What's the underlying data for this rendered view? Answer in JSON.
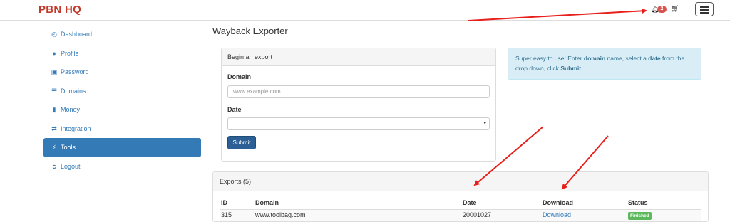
{
  "brand": "PBN HQ",
  "header": {
    "notification_count": "2",
    "bell_icon": "bell-icon",
    "cart_icon": "cart-icon",
    "menu_icon": "hamburger-icon"
  },
  "sidebar": {
    "items": [
      {
        "label": "Dashboard",
        "icon": "dashboard-icon"
      },
      {
        "label": "Profile",
        "icon": "user-icon"
      },
      {
        "label": "Password",
        "icon": "lock-icon"
      },
      {
        "label": "Domains",
        "icon": "server-icon"
      },
      {
        "label": "Money",
        "icon": "bar-chart-icon"
      },
      {
        "label": "Integration",
        "icon": "shuffle-icon"
      },
      {
        "label": "Tools",
        "icon": "bolt-icon",
        "active": true
      },
      {
        "label": "Logout",
        "icon": "logout-icon"
      }
    ]
  },
  "page_title": "Wayback Exporter",
  "form": {
    "heading": "Begin an export",
    "domain_label": "Domain",
    "domain_placeholder": "www.example.com",
    "date_label": "Date",
    "date_value": "",
    "submit_label": "Submit"
  },
  "info": {
    "part1": "Super easy to use! Enter ",
    "strong1": "domain",
    "part2": " name, select a ",
    "strong2": "date",
    "part3": " from the drop down, click ",
    "strong3": "Submit",
    "part4": "."
  },
  "exports": {
    "heading": "Exports (5)",
    "columns": [
      "ID",
      "Domain",
      "Date",
      "Download",
      "Status"
    ],
    "rows": [
      {
        "id": "315",
        "domain": "www.toolbag.com",
        "date": "20001027",
        "download": "Download",
        "status": "Finished"
      }
    ]
  },
  "colors": {
    "brand": "#c0392b",
    "accent": "#337ab7",
    "annotation": "#e8201c",
    "status_finished": "#5cb85c"
  }
}
